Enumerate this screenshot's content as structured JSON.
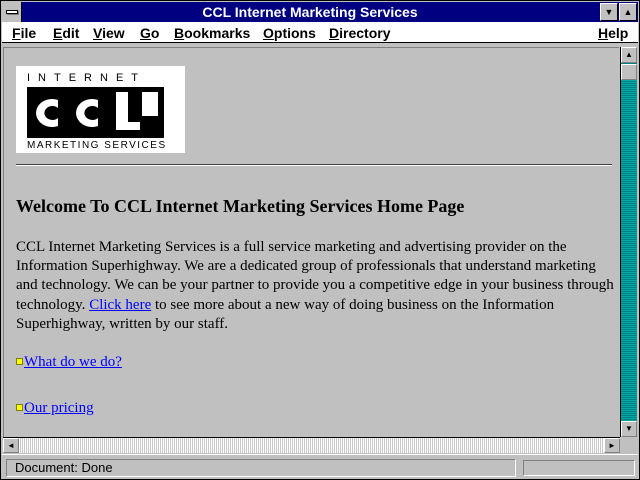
{
  "window": {
    "title": "CCL Internet Marketing Services",
    "minimize_glyph": "▼",
    "maximize_glyph": "▲"
  },
  "menu": {
    "file": "File",
    "edit": "Edit",
    "view": "View",
    "go": "Go",
    "bookmarks": "Bookmarks",
    "options": "Options",
    "directory": "Directory",
    "help": "Help"
  },
  "page": {
    "logo": {
      "top_text": "INTERNET",
      "brand": "CCL",
      "bottom_text": "MARKETING SERVICES"
    },
    "heading": "Welcome To CCL Internet Marketing Services Home Page",
    "paragraph_before_link": "CCL Internet Marketing Services is a full service marketing and advertising provider on the Information Superhighway. We are a dedicated group of professionals that understand marketing and technology. We can be your partner to provide you a competitive edge in your business through technology. ",
    "click_here": "Click here",
    "paragraph_after_link": " to see more about a new way of doing business on the Information Superhighway, written by our staff.",
    "links": [
      {
        "label": "What do we do?"
      },
      {
        "label": "Our pricing"
      }
    ]
  },
  "scrollbars": {
    "up": "▲",
    "down": "▼",
    "left": "◄",
    "right": "►"
  },
  "status": {
    "text": "Document: Done",
    "progress": 0
  },
  "colors": {
    "title_bar": "#000080",
    "link": "#0000ff",
    "bullet": "#ffff00",
    "window_bg": "#c0c0c0",
    "scroll_track": "#008080"
  }
}
